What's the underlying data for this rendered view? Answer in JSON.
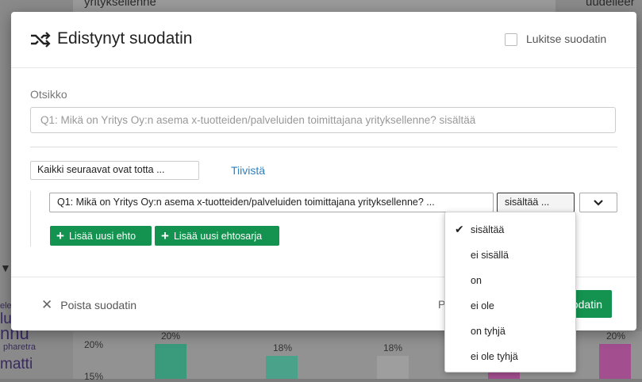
{
  "background": {
    "top_left_text": "yrityksellenne",
    "top_right_text": "uudelleer",
    "left_text_1": "ele",
    "left_text_2": "lu",
    "left_text_3": "nnu",
    "left_text_4": "pharetra",
    "left_text_5": "matti",
    "axis_20": "20%",
    "axis_15": "15%",
    "bar_labels": [
      "20%",
      "18%",
      "18%",
      "20%"
    ],
    "bar_colors": [
      "#3a9a7c",
      "#4aa28a",
      "#9e9e9e",
      "#a24e8f"
    ]
  },
  "modal": {
    "title": "Edistynyt suodatin",
    "lock_label": "Lukitse suodatin",
    "title_field_label": "Otsikko",
    "title_field_placeholder": "Q1: Mikä on Yritys Oy:n asema x-tuotteiden/palveluiden toimittajana yrityksellenne?  sisältää",
    "scope_select_value": "Kaikki seuraavat ovat totta ...",
    "collapse_link": "Tiivistä",
    "condition": {
      "field": "Q1: Mikä on Yritys Oy:n asema x-tuotteiden/palveluiden toimittajana yrityksellenne? ...",
      "operator": "sisältää ..."
    },
    "add_condition_label": "Lisää uusi ehto",
    "add_condition_set_label": "Lisää uusi ehtosarja",
    "remove_filter_label": "Poista suodatin",
    "footer_hidden_text": "P",
    "apply_label": "odatin"
  },
  "operator_menu": {
    "items": [
      "sisältää",
      "ei sisällä",
      "on",
      "ei ole",
      "on tyhjä",
      "ei ole tyhjä"
    ],
    "selected": "sisältää"
  },
  "colors": {
    "primary_green": "#13934f",
    "link_blue": "#2d7fc0"
  }
}
